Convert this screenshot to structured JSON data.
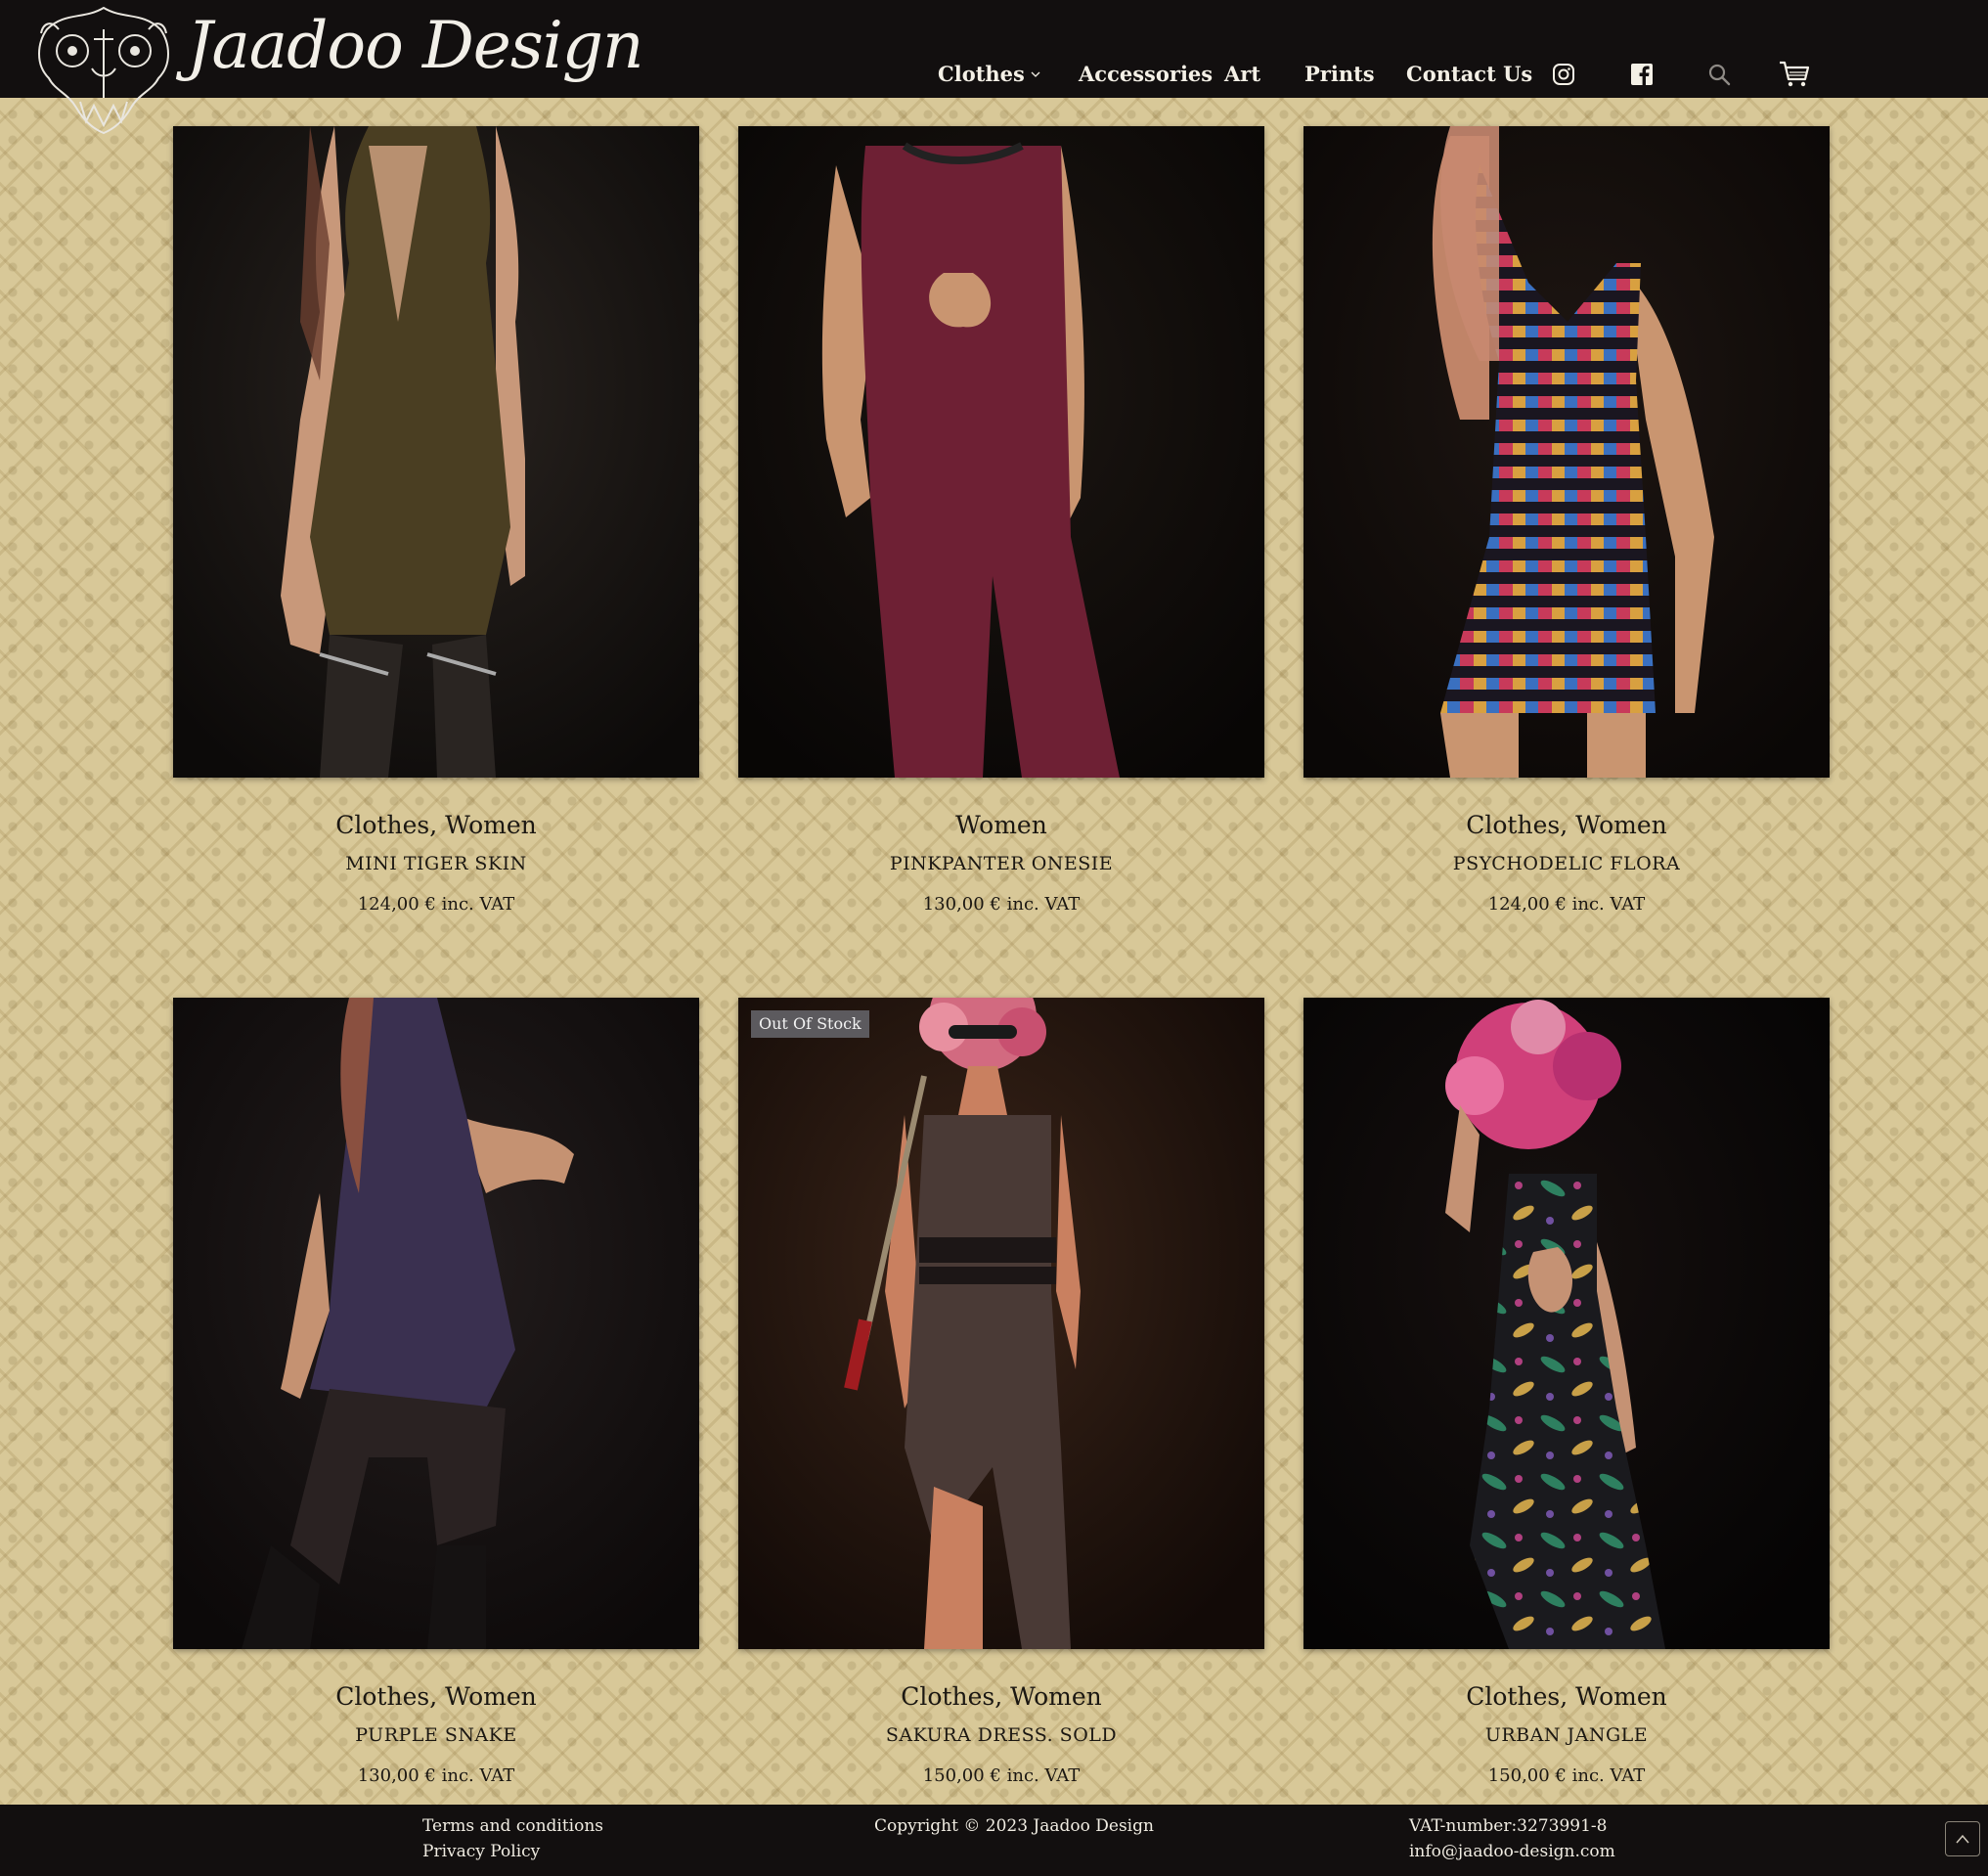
{
  "brand": {
    "name": "Jaadoo Design"
  },
  "nav": {
    "items": [
      {
        "label": "Clothes",
        "has_dropdown": true
      },
      {
        "label": "Accessories"
      },
      {
        "label": "Art"
      },
      {
        "label": "Prints"
      },
      {
        "label": "Contact Us"
      }
    ],
    "icons": [
      "instagram-icon",
      "facebook-icon",
      "search-icon",
      "cart-icon"
    ]
  },
  "products": [
    {
      "category": "Clothes, Women",
      "name": "MINI TIGER SKIN",
      "price": "124,00 € inc. VAT",
      "badge": ""
    },
    {
      "category": "Women",
      "name": "PINKPANTER ONESIE",
      "price": "130,00 € inc. VAT",
      "badge": ""
    },
    {
      "category": "Clothes, Women",
      "name": "PSYCHODELIC FLORA",
      "price": "124,00 € inc. VAT",
      "badge": ""
    },
    {
      "category": "Clothes, Women",
      "name": "PURPLE SNAKE",
      "price": "130,00 € inc. VAT",
      "badge": ""
    },
    {
      "category": "Clothes, Women",
      "name": "SAKURA DRESS. SOLD",
      "price": "150,00 € inc. VAT",
      "badge": "Out Of Stock"
    },
    {
      "category": "Clothes, Women",
      "name": "URBAN JANGLE",
      "price": "150,00 € inc. VAT",
      "badge": ""
    }
  ],
  "footer": {
    "terms": "Terms and conditions",
    "privacy": "Privacy Policy",
    "copyright": "Copyright © 2023 Jaadoo Design",
    "vat": "VAT-number:3273991-8",
    "email": "info@jaadoo-design.com"
  },
  "colors": {
    "header_bg": "#120f0f",
    "page_bg": "#d8c898",
    "text": "#1b1712",
    "badge_bg": "#5c5a5e"
  }
}
